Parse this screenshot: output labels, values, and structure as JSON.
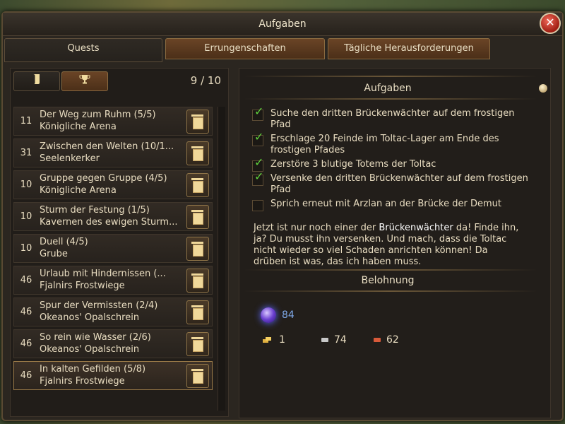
{
  "window": {
    "title": "Aufgaben",
    "close_label": "✕"
  },
  "tabs": [
    {
      "label": "Quests"
    },
    {
      "label": "Errungenschaften"
    },
    {
      "label": "Tägliche Herausforderungen"
    }
  ],
  "quest_panel": {
    "count": "9 / 10",
    "quests": [
      {
        "level": "11",
        "title": "Der Weg zum Ruhm (5/5)",
        "location": "Königliche Arena"
      },
      {
        "level": "31",
        "title": "Zwischen den Welten (10/1...",
        "location": "Seelenkerker"
      },
      {
        "level": "10",
        "title": "Gruppe gegen Gruppe (4/5)",
        "location": "Königliche Arena"
      },
      {
        "level": "10",
        "title": "Sturm der Festung (1/5)",
        "location": "Kavernen des ewigen Sturm..."
      },
      {
        "level": "10",
        "title": "Duell (4/5)",
        "location": "Grube"
      },
      {
        "level": "46",
        "title": "Urlaub mit Hindernissen (...",
        "location": "Fjalnirs Frostwiege"
      },
      {
        "level": "46",
        "title": "Spur der Vermissten (2/4)",
        "location": "Okeanos' Opalschrein"
      },
      {
        "level": "46",
        "title": "So rein wie Wasser (2/6)",
        "location": "Okeanos' Opalschrein"
      },
      {
        "level": "46",
        "title": "In kalten Gefilden (5/8)",
        "location": "Fjalnirs Frostwiege"
      }
    ]
  },
  "details": {
    "tasks_title": "Aufgaben",
    "tasks": [
      {
        "text": "Suche den dritten Brückenwächter auf dem frostigen Pfad",
        "done": true
      },
      {
        "text": "Erschlage 20 Feinde im Toltac-Lager am Ende des frostigen Pfades",
        "done": true
      },
      {
        "text": "Zerstöre 3 blutige Totems der Toltac",
        "done": true
      },
      {
        "text": "Versenke den dritten Brückenwächter auf dem frostigen Pfad",
        "done": true
      },
      {
        "text": "Sprich erneut mit Arzlan an der Brücke der Demut",
        "done": false
      }
    ],
    "desc_before": "Jetzt ist nur noch einer der ",
    "desc_highlight": "Brückenwächter",
    "desc_after": " da! Finde ihn, ja? Du musst ihn versenken. Und mach, dass die Toltac nicht wieder so viel Schaden anrichten können! Da drüben ist was, das ich haben muss.",
    "reward_title": "Belohnung",
    "xp": "84",
    "gold": "1",
    "silver": "74",
    "copper": "62"
  },
  "colors": {
    "accent": "#9a7a48",
    "check": "#5fcf3c",
    "xp": "#7fa8e8"
  },
  "icons": {
    "tab1": "scroll-icon",
    "tab2": "trophy-icon"
  }
}
